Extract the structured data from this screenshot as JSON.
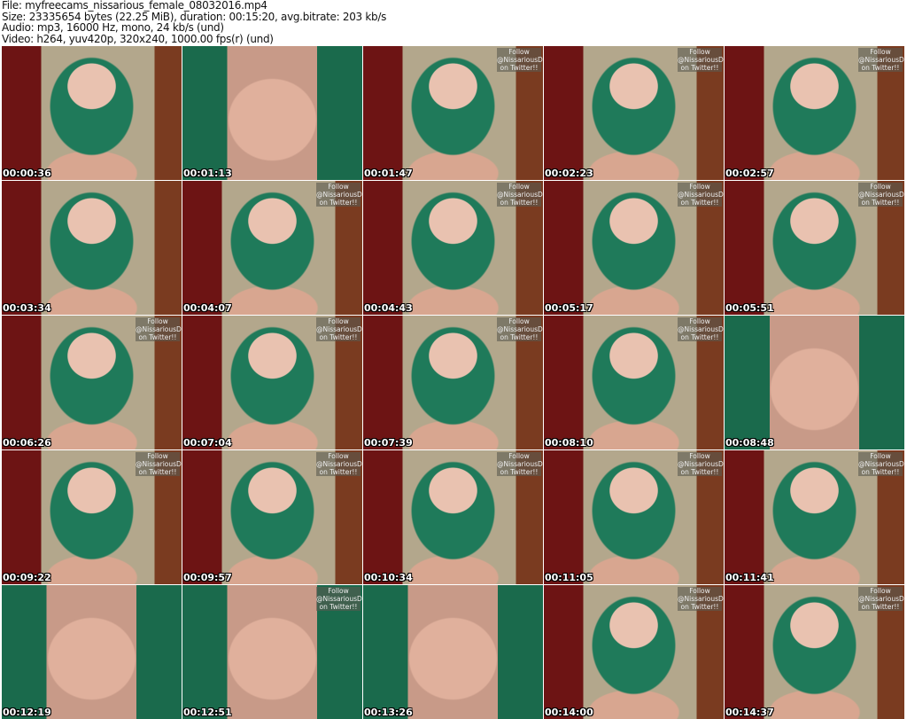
{
  "header": {
    "file": "File: myfreecams_nissarious_female_08032016.mp4",
    "size": "Size: 23335654 bytes (22.25 MiB), duration: 00:15:20, avg.bitrate: 203 kb/s",
    "audio": "Audio: mp3, 16000 Hz, mono, 24 kb/s (und)",
    "video": "Video: h264, yuv420p, 320x240, 1000.00 fps(r) (und)"
  },
  "overlay": {
    "line1": "Follow",
    "line2": "@NissariousD",
    "line3": "on Twitter!!"
  },
  "thumbnails": [
    {
      "time": "00:00:36",
      "overlay": false
    },
    {
      "time": "00:01:13",
      "overlay": false,
      "closeup": true
    },
    {
      "time": "00:01:47",
      "overlay": true
    },
    {
      "time": "00:02:23",
      "overlay": true
    },
    {
      "time": "00:02:57",
      "overlay": true
    },
    {
      "time": "00:03:34",
      "overlay": false
    },
    {
      "time": "00:04:07",
      "overlay": true
    },
    {
      "time": "00:04:43",
      "overlay": true
    },
    {
      "time": "00:05:17",
      "overlay": true
    },
    {
      "time": "00:05:51",
      "overlay": true
    },
    {
      "time": "00:06:26",
      "overlay": true
    },
    {
      "time": "00:07:04",
      "overlay": true
    },
    {
      "time": "00:07:39",
      "overlay": true
    },
    {
      "time": "00:08:10",
      "overlay": true
    },
    {
      "time": "00:08:48",
      "overlay": false,
      "closeup": true
    },
    {
      "time": "00:09:22",
      "overlay": true
    },
    {
      "time": "00:09:57",
      "overlay": true
    },
    {
      "time": "00:10:34",
      "overlay": true
    },
    {
      "time": "00:11:05",
      "overlay": true
    },
    {
      "time": "00:11:41",
      "overlay": true
    },
    {
      "time": "00:12:19",
      "overlay": false,
      "closeup": true
    },
    {
      "time": "00:12:51",
      "overlay": true,
      "closeup": true
    },
    {
      "time": "00:13:26",
      "overlay": false,
      "closeup": true
    },
    {
      "time": "00:14:00",
      "overlay": true
    },
    {
      "time": "00:14:37",
      "overlay": true
    }
  ]
}
